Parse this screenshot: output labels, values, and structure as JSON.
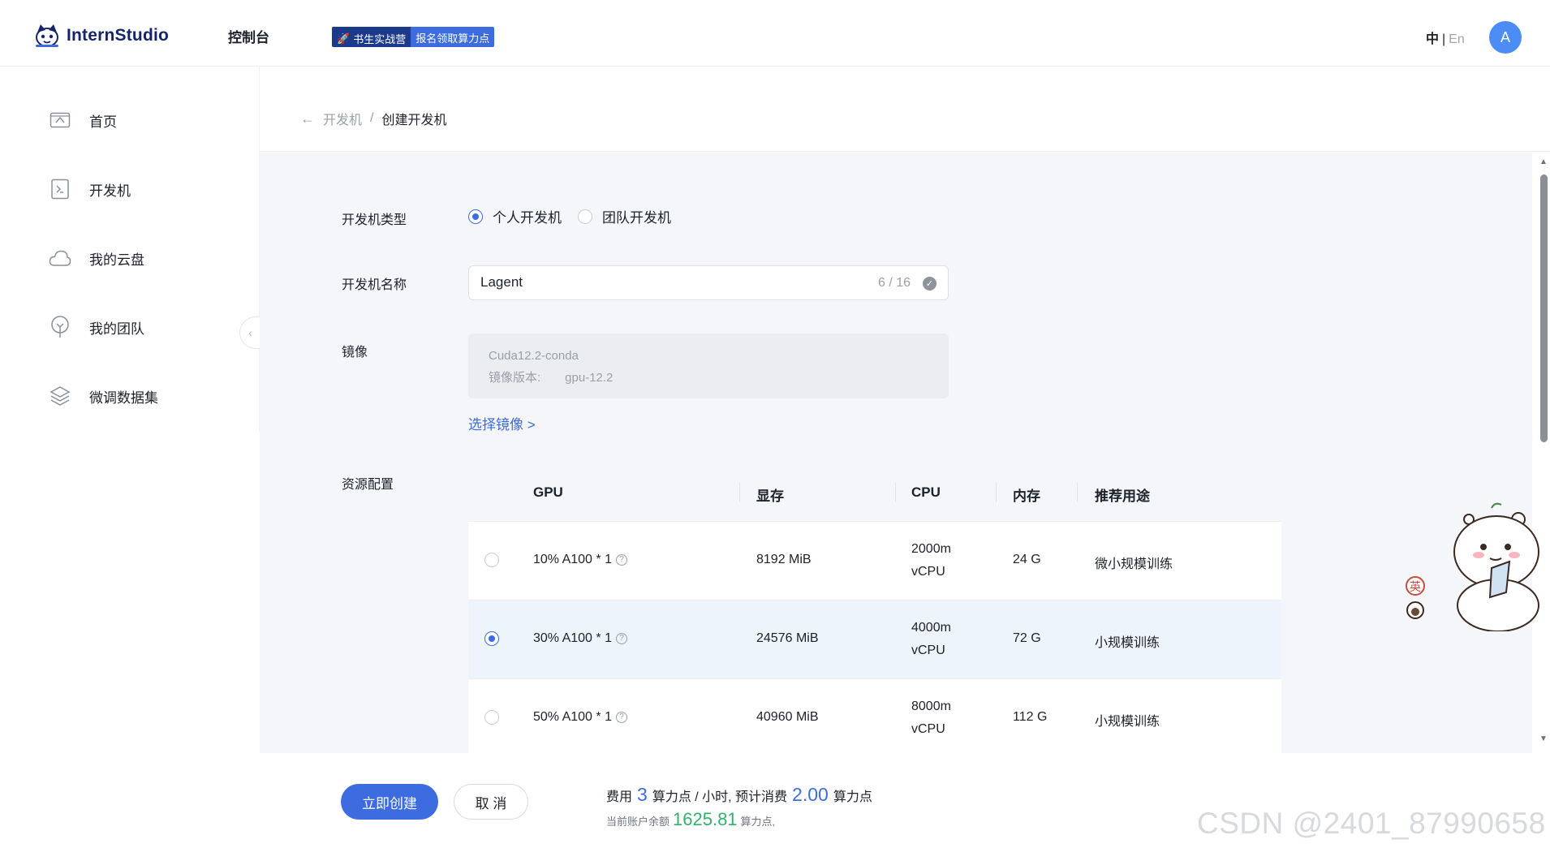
{
  "header": {
    "brand": "InternStudio",
    "nav_console": "控制台",
    "promo_a": "书生实战营",
    "promo_b": "报名领取算力点",
    "lang_cn": "中",
    "lang_sep": "|",
    "lang_en": "En",
    "avatar_letter": "A"
  },
  "sidebar": {
    "items": [
      {
        "label": "首页",
        "icon": "home-icon"
      },
      {
        "label": "开发机",
        "icon": "terminal-icon"
      },
      {
        "label": "我的云盘",
        "icon": "cloud-icon"
      },
      {
        "label": "我的团队",
        "icon": "team-icon"
      },
      {
        "label": "微调数据集",
        "icon": "layers-icon"
      }
    ],
    "collapse_glyph": "‹"
  },
  "breadcrumb": {
    "back_glyph": "←",
    "prev": "开发机",
    "sep": "/",
    "current": "创建开发机"
  },
  "form": {
    "type_label": "开发机类型",
    "type_options": [
      "个人开发机",
      "团队开发机"
    ],
    "type_selected": "个人开发机",
    "name_label": "开发机名称",
    "name_value": "Lagent",
    "name_count": "6 / 16",
    "image_label": "镜像",
    "image_name": "Cuda12.2-conda",
    "image_version_label": "镜像版本:",
    "image_version": "gpu-12.2",
    "select_image": "选择镜像 >",
    "resource_label": "资源配置"
  },
  "resource_table": {
    "headers": [
      "GPU",
      "显存",
      "CPU",
      "内存",
      "推荐用途"
    ],
    "rows": [
      {
        "gpu": "10% A100 * 1",
        "vram": "8192 MiB",
        "cpu_a": "2000m",
        "cpu_b": "vCPU",
        "mem": "24 G",
        "use": "微小规模训练",
        "selected": false
      },
      {
        "gpu": "30% A100 * 1",
        "vram": "24576 MiB",
        "cpu_a": "4000m",
        "cpu_b": "vCPU",
        "mem": "72 G",
        "use": "小规模训练",
        "selected": true
      },
      {
        "gpu": "50% A100 * 1",
        "vram": "40960 MiB",
        "cpu_a": "8000m",
        "cpu_b": "vCPU",
        "mem": "112 G",
        "use": "小规模训练",
        "selected": false
      }
    ]
  },
  "footer": {
    "create_label": "立即创建",
    "cancel_label": "取 消",
    "cost_prefix": "费用",
    "cost_rate": "3",
    "cost_mid": "算力点 / 小时, 预计消费",
    "cost_total": "2.00",
    "cost_suffix": "算力点",
    "balance_prefix": "当前账户余额",
    "balance_value": "1625.81",
    "balance_suffix": "算力点,"
  },
  "mascot_badge_text": "英",
  "watermark": "CSDN @2401_87990658",
  "colors": {
    "primary": "#3c6ce0",
    "brand_dark": "#16246b",
    "balance_green": "#34b26d",
    "page_bg": "#f4f6f9"
  }
}
